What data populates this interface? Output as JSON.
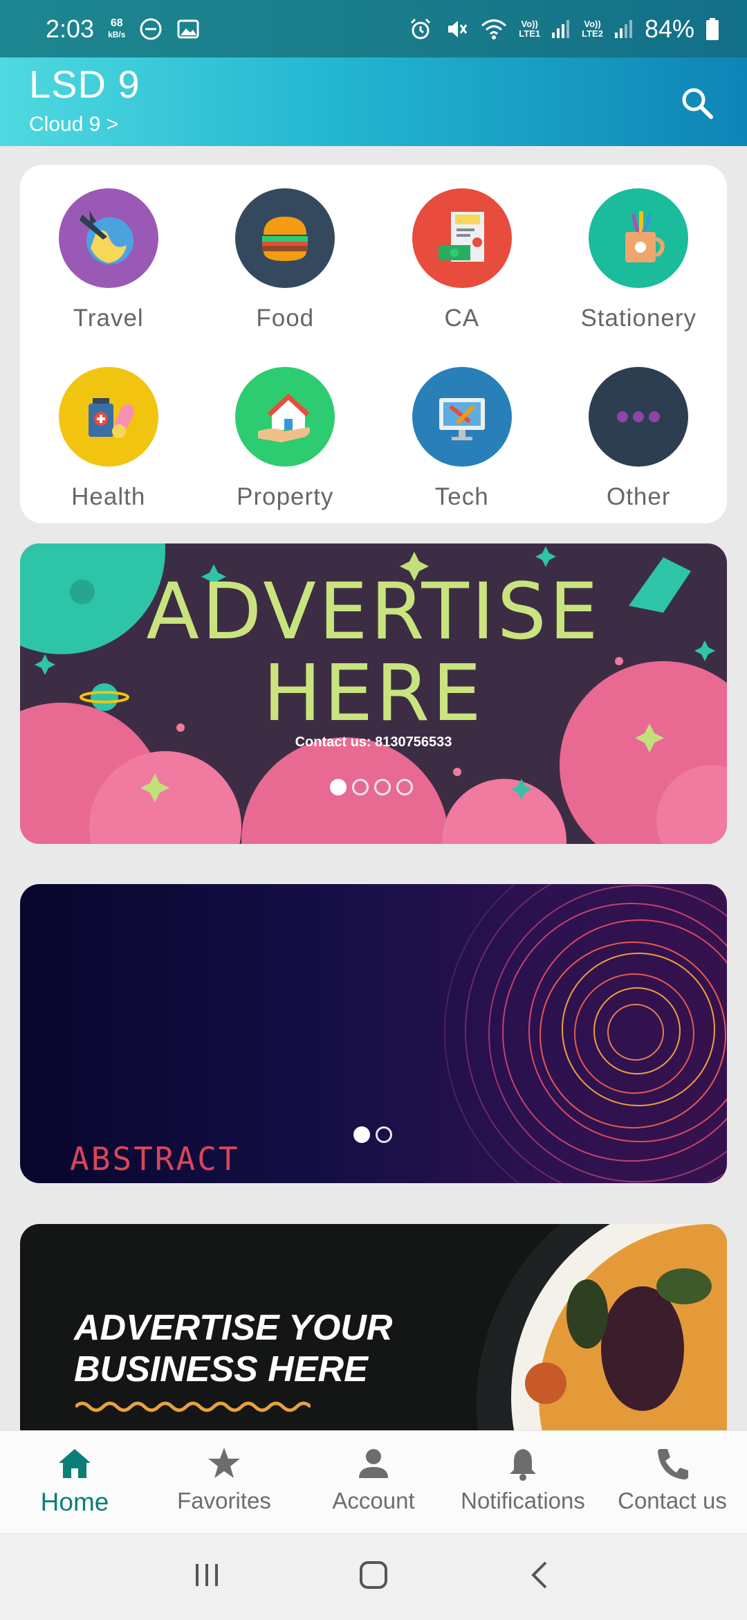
{
  "status_bar": {
    "time": "2:03",
    "net_speed_value": "68",
    "net_speed_unit": "kB/s",
    "sim1": "Vo))\nLTE1",
    "sim2": "Vo))\nLTE2",
    "battery": "84%"
  },
  "app_bar": {
    "title": "LSD 9",
    "subtitle": "Cloud 9  >",
    "search_icon": "search-icon"
  },
  "categories": [
    {
      "label": "Travel",
      "icon": "travel-icon",
      "color": "#9b59b6"
    },
    {
      "label": "Food",
      "icon": "food-icon",
      "color": "#34495e"
    },
    {
      "label": "CA",
      "icon": "ca-icon",
      "color": "#e74c3c"
    },
    {
      "label": "Stationery",
      "icon": "stationery-icon",
      "color": "#1abc9c"
    },
    {
      "label": "Health",
      "icon": "health-icon",
      "color": "#f1c40f"
    },
    {
      "label": "Property",
      "icon": "property-icon",
      "color": "#2ecc71"
    },
    {
      "label": "Tech",
      "icon": "tech-icon",
      "color": "#2980b9"
    },
    {
      "label": "Other",
      "icon": "more-icon",
      "color": "#2c3e50"
    }
  ],
  "banners": {
    "banner1": {
      "line1": "ADVERTISE",
      "line2": "HERE",
      "contact": "Contact us: 8130756533",
      "dots": 4,
      "active": 0
    },
    "banner2": {
      "caption": "ABSTRACT",
      "dots": 2,
      "active": 0
    },
    "banner3": {
      "line1": "ADVERTISE YOUR",
      "line2": "BUSINESS HERE"
    }
  },
  "bottom_nav": [
    {
      "label": "Home",
      "icon": "home-icon",
      "active": true
    },
    {
      "label": "Favorites",
      "icon": "star-icon",
      "active": false
    },
    {
      "label": "Account",
      "icon": "account-icon",
      "active": false
    },
    {
      "label": "Notifications",
      "icon": "bell-icon",
      "active": false
    },
    {
      "label": "Contact us",
      "icon": "phone-icon",
      "active": false
    }
  ],
  "colors": {
    "accent": "#0b7e77",
    "app_bar_start": "#4fd9e0",
    "app_bar_end": "#0e84b6"
  }
}
